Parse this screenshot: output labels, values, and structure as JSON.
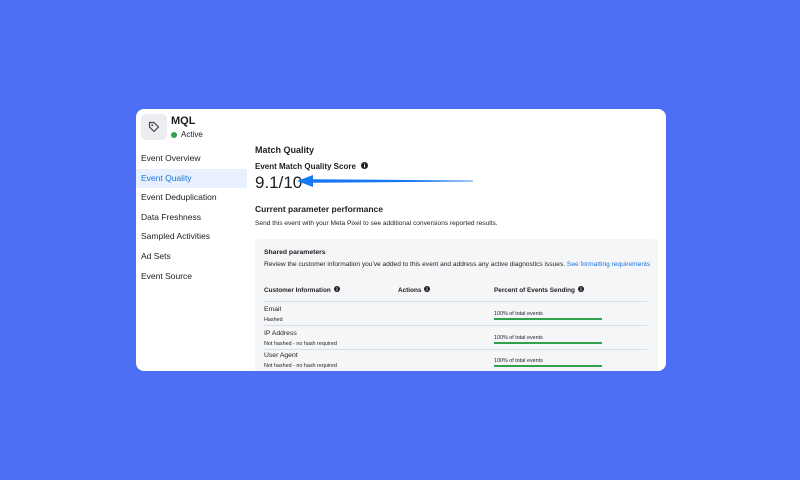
{
  "event": {
    "name": "MQL",
    "status": "Active",
    "icon": "tag-icon",
    "status_color": "#31a24c"
  },
  "sidebar": {
    "items": [
      {
        "label": "Event Overview",
        "active": false
      },
      {
        "label": "Event Quality",
        "active": true
      },
      {
        "label": "Event Deduplication",
        "active": false
      },
      {
        "label": "Data Freshness",
        "active": false
      },
      {
        "label": "Sampled Activities",
        "active": false
      },
      {
        "label": "Ad Sets",
        "active": false
      },
      {
        "label": "Event Source",
        "active": false
      }
    ]
  },
  "main": {
    "section_title": "Match Quality",
    "score_label": "Event Match Quality Score",
    "score_value": "9.1/10",
    "parameter_title": "Current parameter performance",
    "parameter_desc": "Send this event with your Meta Pixel to see additional conversions reported results."
  },
  "shared": {
    "title": "Shared parameters",
    "desc": "Review the customer information you've added to this event and address any active diagnostics issues.",
    "link": "See formatting requirements",
    "headers": [
      "Customer Information",
      "Actions",
      "Percent of Events Sending"
    ],
    "rows": [
      {
        "name": "Email",
        "note": "Hashed",
        "percent_label": "100% of total events",
        "percent": 100
      },
      {
        "name": "IP Address",
        "note": "Not hashed - no hash required",
        "percent_label": "100% of total events",
        "percent": 100
      },
      {
        "name": "User Agent",
        "note": "Not hashed - no hash required",
        "percent_label": "100% of total events",
        "percent": 100
      }
    ]
  },
  "colors": {
    "background": "#4d6ff5",
    "accent": "#1b74e4",
    "success": "#31a24c",
    "arrow": "#1877f2"
  }
}
